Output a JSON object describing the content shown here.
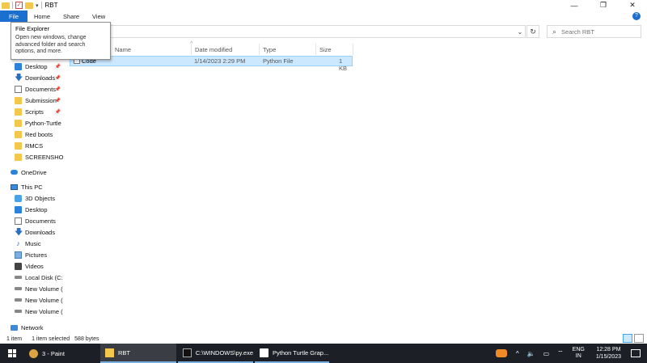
{
  "window": {
    "title": "RBT",
    "qa_arrow": "▾",
    "minimize": "—",
    "maximize": "❐",
    "close": "✕"
  },
  "ribbon": {
    "tabs": [
      "File",
      "Home",
      "Share",
      "View"
    ],
    "help": "?"
  },
  "address": {
    "dropdown": "⌄",
    "refresh": "↻",
    "search_placeholder": "Search RBT",
    "search_icon": "⌕"
  },
  "tooltip": {
    "title": "File Explorer",
    "description": "Open new windows, change advanced folder and search options, and more."
  },
  "sidebar": {
    "pin_icon": "📌",
    "quick_access": [
      {
        "label": "Desktop",
        "icon": "desktop-icon",
        "pinned": true
      },
      {
        "label": "Downloads",
        "icon": "downloads-icon",
        "pinned": true
      },
      {
        "label": "Documents",
        "icon": "documents-icon",
        "pinned": true
      },
      {
        "label": "Submission",
        "icon": "folder-icon",
        "pinned": true
      },
      {
        "label": "Scripts",
        "icon": "folder-icon",
        "pinned": true
      },
      {
        "label": "Python-Turtle",
        "icon": "folder-icon",
        "pinned": false
      },
      {
        "label": "Red boots",
        "icon": "folder-icon",
        "pinned": false
      },
      {
        "label": "RMCS",
        "icon": "folder-icon",
        "pinned": false
      },
      {
        "label": "SCREENSHOTS",
        "icon": "folder-icon",
        "pinned": false
      }
    ],
    "onedrive": "OneDrive",
    "this_pc": "This PC",
    "pc_items": [
      {
        "label": "3D Objects",
        "icon": "3d-objects-icon"
      },
      {
        "label": "Desktop",
        "icon": "desktop-icon"
      },
      {
        "label": "Documents",
        "icon": "documents-icon"
      },
      {
        "label": "Downloads",
        "icon": "downloads-icon"
      },
      {
        "label": "Music",
        "icon": "music-icon"
      },
      {
        "label": "Pictures",
        "icon": "pictures-icon"
      },
      {
        "label": "Videos",
        "icon": "videos-icon"
      },
      {
        "label": "Local Disk (C:)",
        "icon": "disk-icon"
      },
      {
        "label": "New Volume (",
        "icon": "disk-icon"
      },
      {
        "label": "New Volume (",
        "icon": "disk-icon"
      },
      {
        "label": "New Volume (",
        "icon": "disk-icon"
      }
    ],
    "network": "Network"
  },
  "file_list": {
    "sort_arrow": "^",
    "columns": {
      "name": "Name",
      "date": "Date modified",
      "type": "Type",
      "size": "Size"
    },
    "rows": [
      {
        "name": "Code",
        "date": "1/14/2023 2:29 PM",
        "type": "Python File",
        "size": "1 KB"
      }
    ]
  },
  "status": {
    "count": "1 item",
    "selected": "1 item selected",
    "size": "588 bytes"
  },
  "taskbar": {
    "tasks": [
      {
        "label": "3 - Paint",
        "icon": "paint-icon"
      },
      {
        "label": "RBT",
        "icon": "explorer-icon"
      },
      {
        "label": "C:\\WINDOWS\\py.exe",
        "icon": "cmd-icon"
      },
      {
        "label": "Python Turtle Grap...",
        "icon": "turtle-icon"
      }
    ],
    "tray": {
      "chevron": "^",
      "volume": "🔈",
      "battery": "▭",
      "wifi": "⌔",
      "lang_top": "ENG",
      "lang_bottom": "IN",
      "time": "12:28 PM",
      "date": "1/15/2023"
    }
  }
}
